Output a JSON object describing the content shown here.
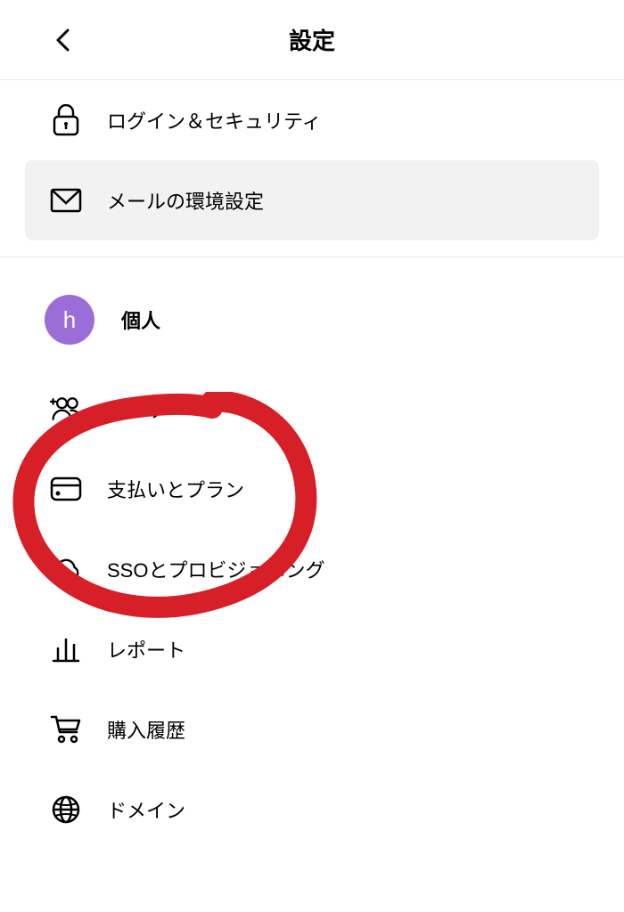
{
  "header": {
    "title": "設定"
  },
  "section1": {
    "items": [
      {
        "label": "ログイン＆セキュリティ",
        "icon": "lock"
      },
      {
        "label": "メールの環境設定",
        "icon": "mail"
      }
    ]
  },
  "section2": {
    "avatar_letter": "h",
    "title": "個人",
    "items": [
      {
        "label": "ユーザー",
        "icon": "users"
      },
      {
        "label": "支払いとプラン",
        "icon": "card"
      },
      {
        "label": "SSOとプロビジョニング",
        "icon": "cloud"
      },
      {
        "label": "レポート",
        "icon": "chart"
      },
      {
        "label": "購入履歴",
        "icon": "cart"
      },
      {
        "label": "ドメイン",
        "icon": "globe"
      }
    ]
  }
}
